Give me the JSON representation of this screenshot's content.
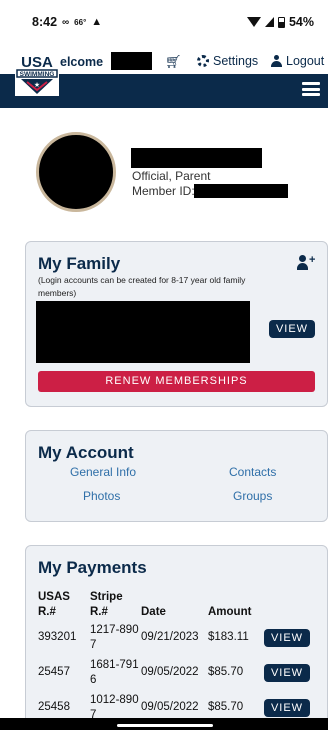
{
  "status_bar": {
    "time": "8:42",
    "temp": "66°",
    "battery": "54%"
  },
  "header": {
    "logo_top": "USA",
    "logo_bottom": "SWIMMING",
    "welcome": "elcome",
    "settings_label": "Settings",
    "logout_label": "Logout",
    "colors": {
      "navy": "#0b2a4a",
      "red": "#cc1f45",
      "link": "#2f6fa8"
    }
  },
  "profile": {
    "role": "Official, Parent",
    "member_id_label": "Member ID:"
  },
  "family": {
    "title": "My Family",
    "note": "(Login accounts can be created for 8-17 year old family members)",
    "view_label": "VIEW",
    "renew_label": "RENEW MEMBERSHIPS"
  },
  "account": {
    "title": "My Account",
    "links": [
      "General Info",
      "Contacts",
      "Photos",
      "Groups"
    ]
  },
  "payments": {
    "title": "My Payments",
    "columns": [
      "USAS R.#",
      "Stripe R.#",
      "Date",
      "Amount"
    ],
    "rows": [
      {
        "usas": "393201",
        "stripe": "1217-8907",
        "date": "09/21/2023",
        "amount": "$183.11",
        "action": "VIEW"
      },
      {
        "usas": "25457",
        "stripe": "1681-7916",
        "date": "09/05/2022",
        "amount": "$85.70",
        "action": "VIEW"
      },
      {
        "usas": "25458",
        "stripe": "1012-8907",
        "date": "09/05/2022",
        "amount": "$85.70",
        "action": "VIEW"
      }
    ]
  }
}
